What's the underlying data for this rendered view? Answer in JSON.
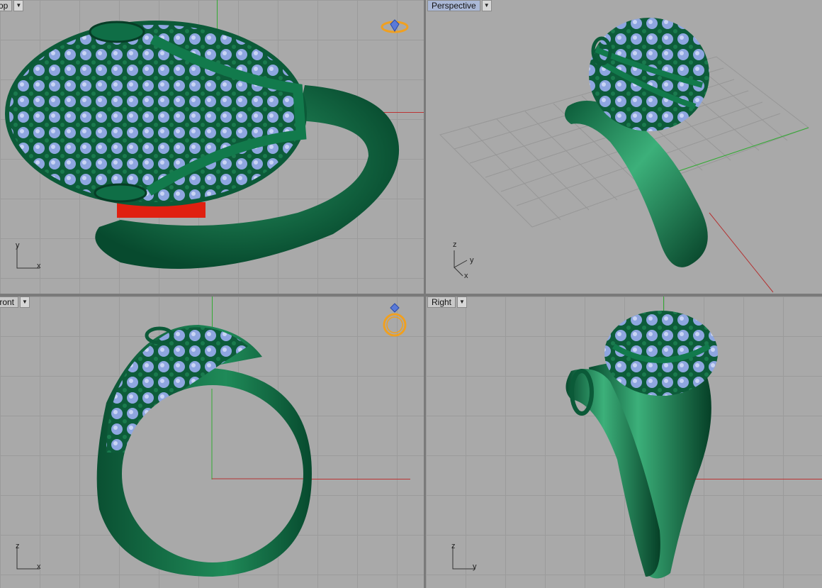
{
  "viewports": {
    "top": {
      "label": "Top",
      "axes": [
        "y",
        "x"
      ]
    },
    "perspective": {
      "label": "Perspective",
      "axes": [
        "z",
        "y",
        "x"
      ]
    },
    "front": {
      "label": "Front",
      "axes": [
        "z",
        "x"
      ]
    },
    "right": {
      "label": "Right",
      "axes": [
        "z",
        "y"
      ]
    }
  },
  "icons": {
    "dropdown": "dropdown-arrow-icon",
    "top_badge": "ring-diamond-icon",
    "front_badge": "ring-icon"
  },
  "colors": {
    "model_green": "#0f6e46",
    "stone_blue": "#8ea6e0",
    "x_axis": "#b33333",
    "y_axis": "#33aa33",
    "badge_orange": "#f0a020"
  }
}
